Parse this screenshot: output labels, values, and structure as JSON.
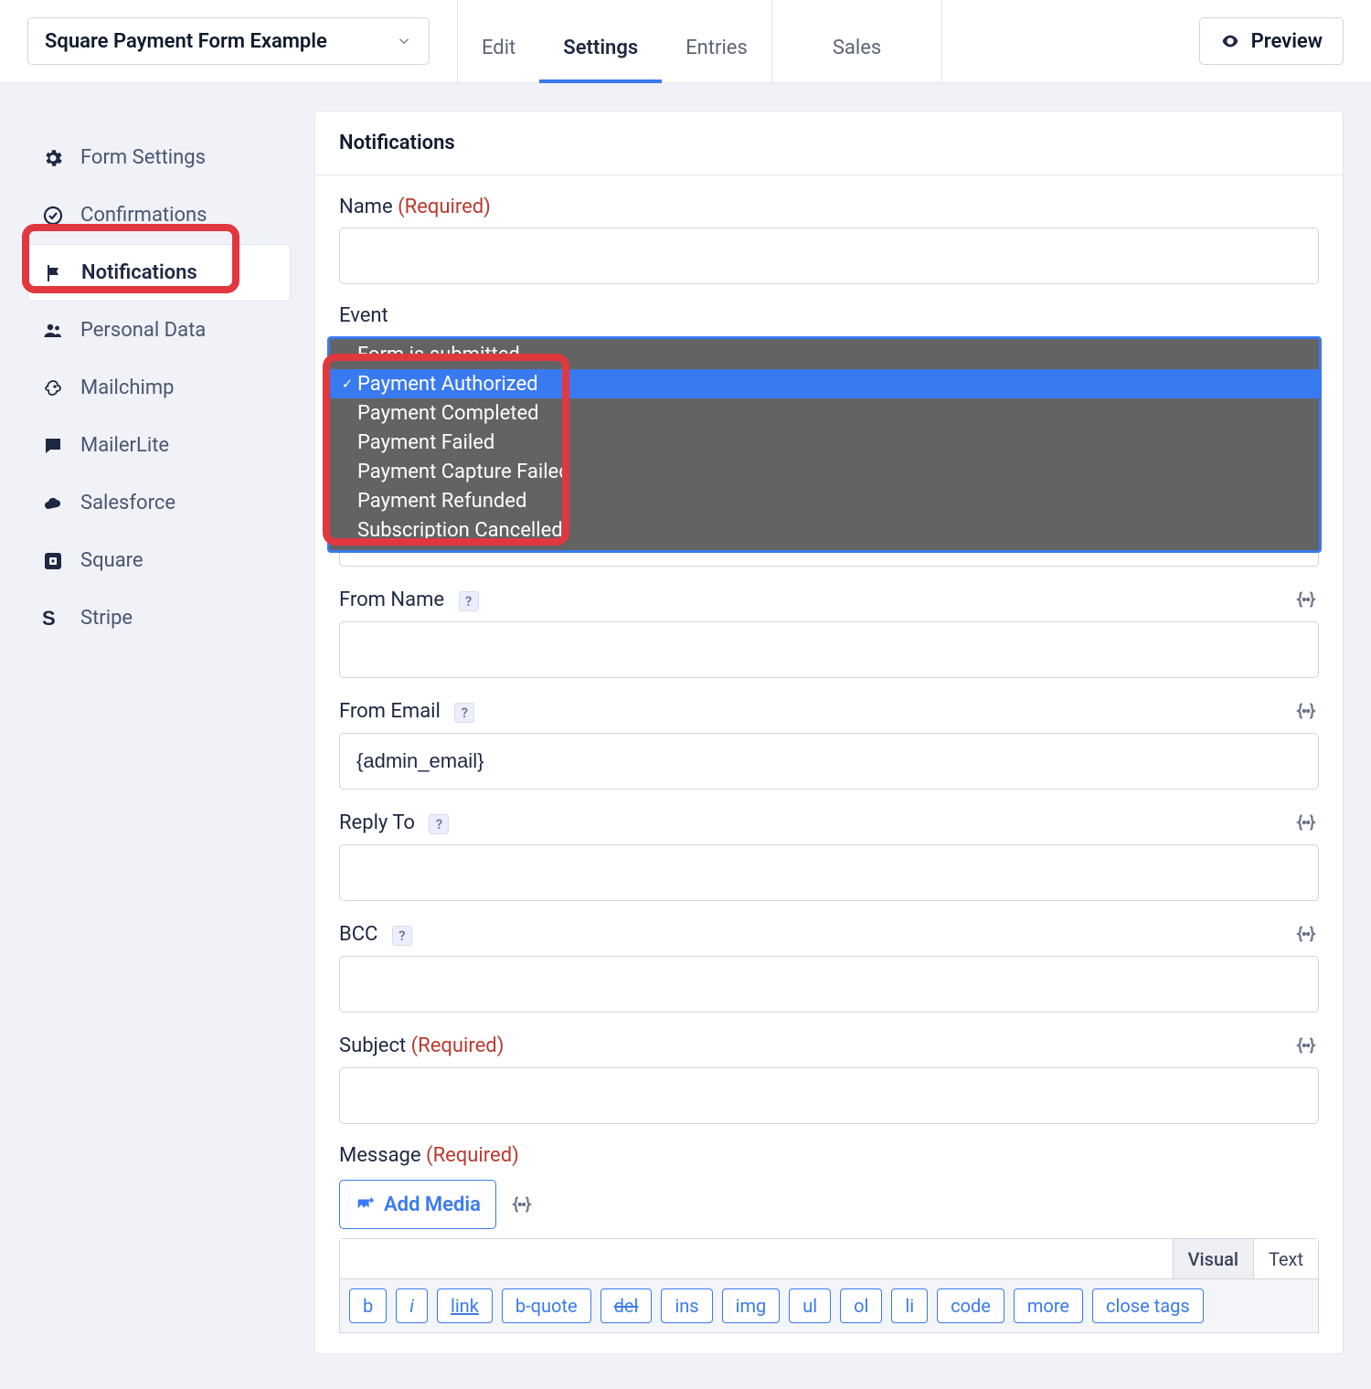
{
  "header": {
    "form_selector": "Square Payment Form Example",
    "tabs": [
      {
        "id": "edit",
        "label": "Edit",
        "active": false
      },
      {
        "id": "settings",
        "label": "Settings",
        "active": true
      },
      {
        "id": "entries",
        "label": "Entries",
        "active": false
      },
      {
        "id": "sales",
        "label": "Sales",
        "active": false
      }
    ],
    "preview_label": "Preview"
  },
  "sidebar": {
    "items": [
      {
        "icon": "gear-icon",
        "label": "Form Settings"
      },
      {
        "icon": "check-circle-icon",
        "label": "Confirmations"
      },
      {
        "icon": "flag-icon",
        "label": "Notifications",
        "active": true
      },
      {
        "icon": "people-icon",
        "label": "Personal Data"
      },
      {
        "icon": "mailchimp-icon",
        "label": "Mailchimp"
      },
      {
        "icon": "chat-icon",
        "label": "MailerLite"
      },
      {
        "icon": "cloud-icon",
        "label": "Salesforce"
      },
      {
        "icon": "square-icon",
        "label": "Square"
      },
      {
        "icon": "stripe-icon",
        "label": "Stripe"
      }
    ]
  },
  "panel": {
    "title": "Notifications",
    "fields": {
      "name_label": "Name",
      "required_label": "(Required)",
      "name_value": "",
      "event_label": "Event",
      "event_options": [
        "Form is submitted",
        "Payment Authorized",
        "Payment Completed",
        "Payment Failed",
        "Payment Capture Failed",
        "Payment Refunded",
        "Subscription Cancelled"
      ],
      "event_selected_index": 1,
      "from_name_label": "From Name",
      "from_name_value": "",
      "from_email_label": "From Email",
      "from_email_value": "{admin_email}",
      "reply_to_label": "Reply To",
      "reply_to_value": "",
      "bcc_label": "BCC",
      "bcc_value": "",
      "subject_label": "Subject",
      "subject_value": "",
      "message_label": "Message",
      "add_media_label": "Add Media",
      "help_marker": "?",
      "editor_tabs": {
        "visual": "Visual",
        "text": "Text"
      },
      "quicktags": [
        "b",
        "i",
        "link",
        "b-quote",
        "del",
        "ins",
        "img",
        "ul",
        "ol",
        "li",
        "code",
        "more",
        "close tags"
      ]
    }
  }
}
